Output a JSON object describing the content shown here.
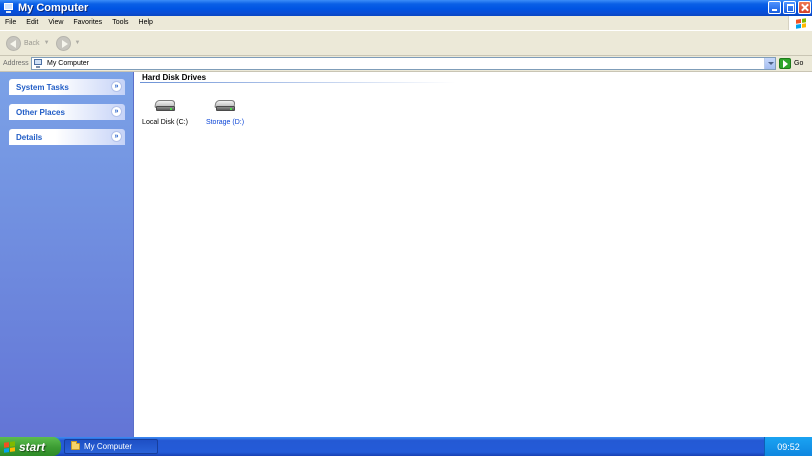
{
  "window": {
    "title": "My Computer",
    "controls": {
      "minimize": "minimize",
      "maximize": "maximize",
      "close": "close"
    }
  },
  "menu": [
    "File",
    "Edit",
    "View",
    "Favorites",
    "Tools",
    "Help"
  ],
  "toolbar": {
    "back_label": "Back",
    "forward_label": ""
  },
  "address": {
    "label": "Address",
    "value": "My Computer",
    "go_label": "Go"
  },
  "taskpane": {
    "panels": [
      {
        "label": "System Tasks",
        "toggle": "»"
      },
      {
        "label": "Other Places",
        "toggle": "»"
      },
      {
        "label": "Details",
        "toggle": "»"
      }
    ]
  },
  "content": {
    "group_title": "Hard Disk Drives",
    "drives": [
      {
        "label": "Local Disk (C:)",
        "icon": "hard-drive-icon"
      },
      {
        "label": "Storage (D:)",
        "icon": "hard-drive-icon"
      }
    ]
  },
  "taskbar": {
    "start_label": "start",
    "tasks": [
      {
        "label": "My Computer",
        "icon": "folder-icon"
      }
    ],
    "clock": "09:52"
  },
  "colors": {
    "titlebar": "#0054e3",
    "taskpane_top": "#7ba2e7",
    "taskpane_bottom": "#6375d6",
    "link_blue": "#215dc6",
    "start_green": "#3c9c33",
    "tray_blue": "#0f87e0"
  }
}
